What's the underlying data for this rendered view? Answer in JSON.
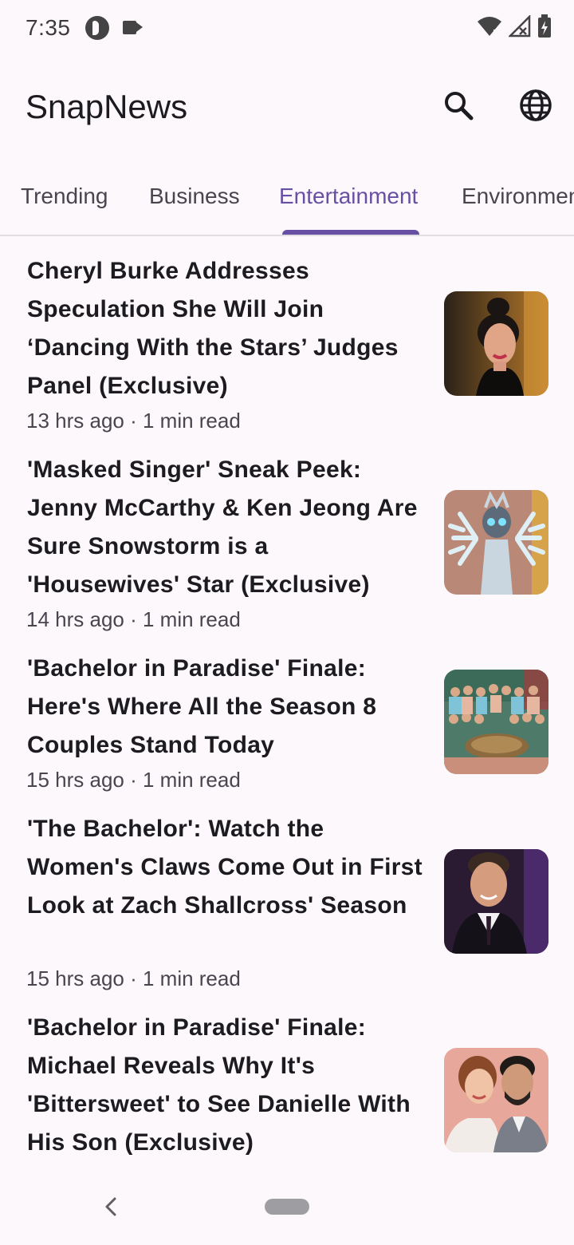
{
  "status_bar": {
    "time": "7:35",
    "icons": [
      "app-notification-icon",
      "video-camera-icon",
      "wifi-icon",
      "signal-icon",
      "battery-charging-icon"
    ]
  },
  "app_bar": {
    "title": "SnapNews",
    "actions": [
      "search-icon",
      "globe-icon"
    ]
  },
  "tabs": {
    "items": [
      "Trending",
      "Business",
      "Entertainment",
      "Environment"
    ],
    "selected": "Entertainment",
    "accent_color": "#6750a4"
  },
  "articles": [
    {
      "title": "Cheryl Burke Addresses Speculation She Will Join ‘Dancing With the Stars’ Judges Panel (Exclusive)",
      "meta": "13 hrs ago · 1 min read"
    },
    {
      "title": "'Masked Singer' Sneak Peek: Jenny McCarthy & Ken Jeong Are Sure Snowstorm is a 'Housewives' Star (Exclusive)",
      "meta": "14 hrs ago · 1 min read"
    },
    {
      "title": "'Bachelor in Paradise' Finale: Here's Where All the Season 8 Couples Stand Today",
      "meta": "15 hrs ago · 1 min read"
    },
    {
      "title": "'The Bachelor': Watch the Women's Claws Come Out in First Look at Zach Shallcross' Season",
      "meta": "15 hrs ago · 1 min read"
    },
    {
      "title": "'Bachelor in Paradise' Finale: Michael Reveals Why It's 'Bittersweet' to See Danielle With His Son (Exclusive)",
      "meta": ""
    }
  ],
  "nav_bar": {
    "icons": [
      "back-icon",
      "home-pill-icon"
    ]
  }
}
